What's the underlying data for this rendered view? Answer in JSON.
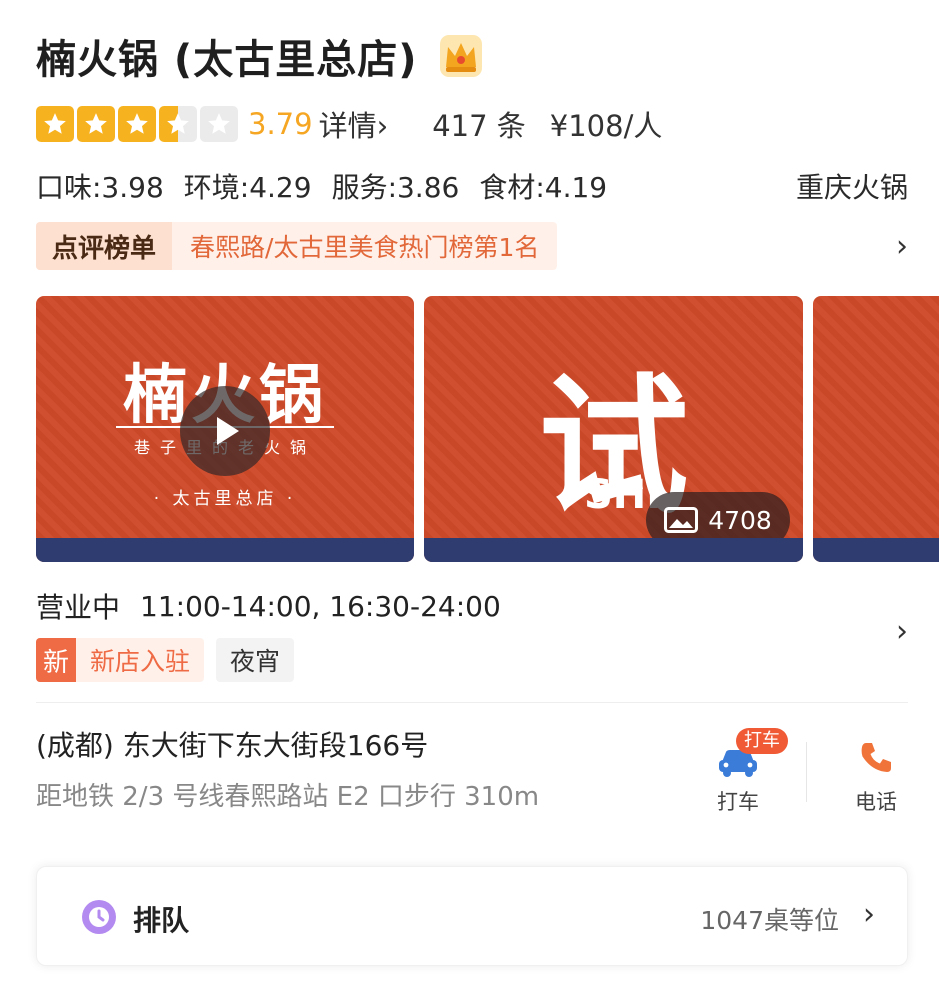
{
  "header": {
    "shop_name": "楠火锅 (太古里总店)",
    "crown_icon": "crown-icon"
  },
  "rating": {
    "stars": 3.5,
    "score": "3.79",
    "detail_label": "详情",
    "reviews": "417 条",
    "price": "¥108/人"
  },
  "sub_scores": {
    "taste": "口味:3.98",
    "environment": "环境:4.29",
    "service": "服务:3.86",
    "ingredients": "食材:4.19",
    "category": "重庆火锅"
  },
  "rank": {
    "badge": "点评榜单",
    "text": "春熙路/太古里美食热门榜第1名"
  },
  "media": {
    "video_logo": "楠火锅",
    "video_subtitle": "巷子里的老火锅",
    "video_branch": "· 太古里总店 ·",
    "photo_big_char": "试",
    "photo_caption": "SHI",
    "photo_count": "4708",
    "colors": {
      "primary": "#c84828",
      "stripe": "#2f3c6f"
    }
  },
  "hours": {
    "status": "营业中",
    "times": "11:00-14:00, 16:30-24:00"
  },
  "tags": {
    "new_badge": "新",
    "new_text": "新店入驻",
    "plain": "夜宵"
  },
  "address": {
    "line": "(成都) 东大街下东大街段166号",
    "metro": "距地铁 2/3 号线春熙路站 E2 口步行 310m"
  },
  "actions": {
    "taxi_badge": "打车",
    "taxi_label": "打车",
    "phone_label": "电话"
  },
  "queue": {
    "label": "排队",
    "count": "1047桌等位"
  },
  "accent": {
    "orange": "#f5a623",
    "red": "#ef6b45",
    "blue": "#3b7cd9"
  }
}
